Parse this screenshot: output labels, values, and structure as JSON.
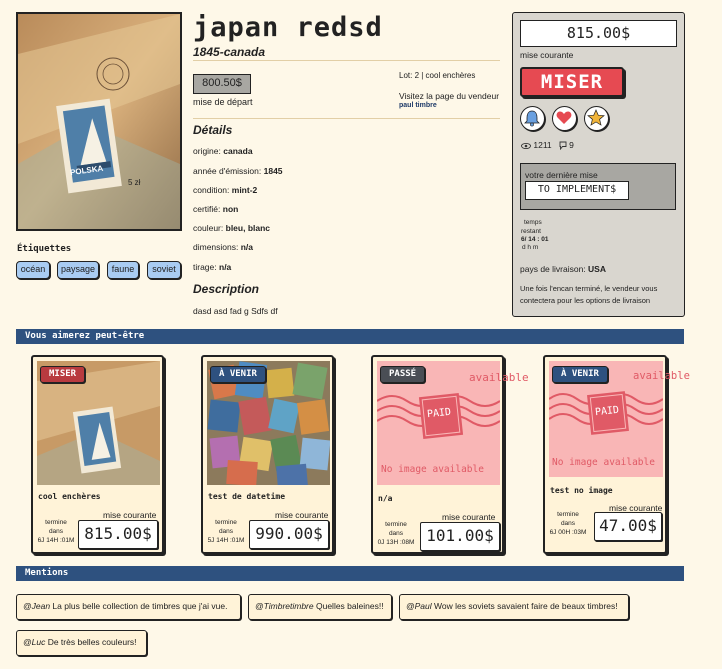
{
  "product": {
    "title": "japan redsd",
    "subtitle": "1845-canada",
    "start_price": "800.50$",
    "start_label": "mise de départ",
    "lot_info": "Lot: 2 | cool enchères",
    "visit_seller": "Visitez la page du vendeur",
    "seller": "paul timbre",
    "stamp_country": "POLSKA",
    "stamp_value": "5 zł"
  },
  "details": {
    "heading": "Détails",
    "rows": [
      {
        "label": "origine:",
        "value": "canada"
      },
      {
        "label": "année d'émission:",
        "value": "1845"
      },
      {
        "label": "condition:",
        "value": "mint-2"
      },
      {
        "label": "certifié:",
        "value": "non"
      },
      {
        "label": "couleur:",
        "value": "bleu, blanc"
      },
      {
        "label": "dimensions:",
        "value": "n/a"
      },
      {
        "label": "tirage:",
        "value": "n/a"
      }
    ]
  },
  "description": {
    "heading": "Description",
    "text": "dasd asd fad g Sdfs df"
  },
  "tags": {
    "title": "Étiquettes",
    "items": [
      "océan",
      "paysage",
      "faune",
      "soviet"
    ]
  },
  "bid_panel": {
    "current_price": "815.00$",
    "current_label": "mise courante",
    "bid_button": "MISER",
    "views": "1211",
    "comments": "9",
    "my_bid_label": "votre dernière mise",
    "my_bid_value": "TO IMPLEMENT$",
    "time_label_1": "temps",
    "time_label_2": "restant",
    "time_value": "6/ 14 : 01",
    "time_units": "d   h   m",
    "ship_label": "pays de livraison:",
    "ship_value": "USA",
    "ship_note": "Une fois l'encan terminé, le vendeur vous contectera pour les options de livraison"
  },
  "icons": {
    "bell": "bell-icon",
    "heart": "heart-icon",
    "star": "star-icon",
    "eye": "eye-icon",
    "comment": "comment-icon"
  },
  "colors": {
    "accent_red": "#e64a52",
    "section_blue": "#2e517f",
    "tag_blue": "#a9ccf2",
    "background": "#fef8e8"
  },
  "recommend": {
    "heading": "Vous aimerez peut-être",
    "cards": [
      {
        "badge": "MISER",
        "title": "cool enchères",
        "cur_label": "mise courante",
        "ends_1": "termine",
        "ends_2": "dans",
        "ends_3": "6J 14H :01M",
        "price": "815.00$"
      },
      {
        "badge": "À VENIR",
        "title": "test de datetime",
        "cur_label": "mise courante",
        "ends_1": "termine",
        "ends_2": "dans",
        "ends_3": "5J 14H :01M",
        "price": "990.00$"
      },
      {
        "badge": "PASSÉ",
        "title": "n/a",
        "cur_label": "mise courante",
        "ends_1": "termine",
        "ends_2": "dans",
        "ends_3": "0J 13H :08M",
        "price": "101.00$",
        "placeholder_text": "No image available",
        "placeholder_top": "available",
        "paid": "PAID"
      },
      {
        "badge": "À VENIR",
        "title": "test no image",
        "cur_label": "mise courante",
        "ends_1": "termine",
        "ends_2": "dans",
        "ends_3": "6J 00H :03M",
        "price": "47.00$",
        "placeholder_text": "No image available",
        "placeholder_top": "available",
        "paid": "PAID"
      }
    ]
  },
  "mentions": {
    "heading": "Mentions",
    "items": [
      {
        "user": "@Jean",
        "text": " La plus belle collection de timbres que j'ai vue."
      },
      {
        "user": "@Timbretimbre",
        "text": " Quelles baleines!!"
      },
      {
        "user": "@Paul",
        "text": " Wow les soviets savaient faire de beaux timbres!"
      },
      {
        "user": "@Luc",
        "text": " De très belles couleurs!"
      }
    ]
  }
}
